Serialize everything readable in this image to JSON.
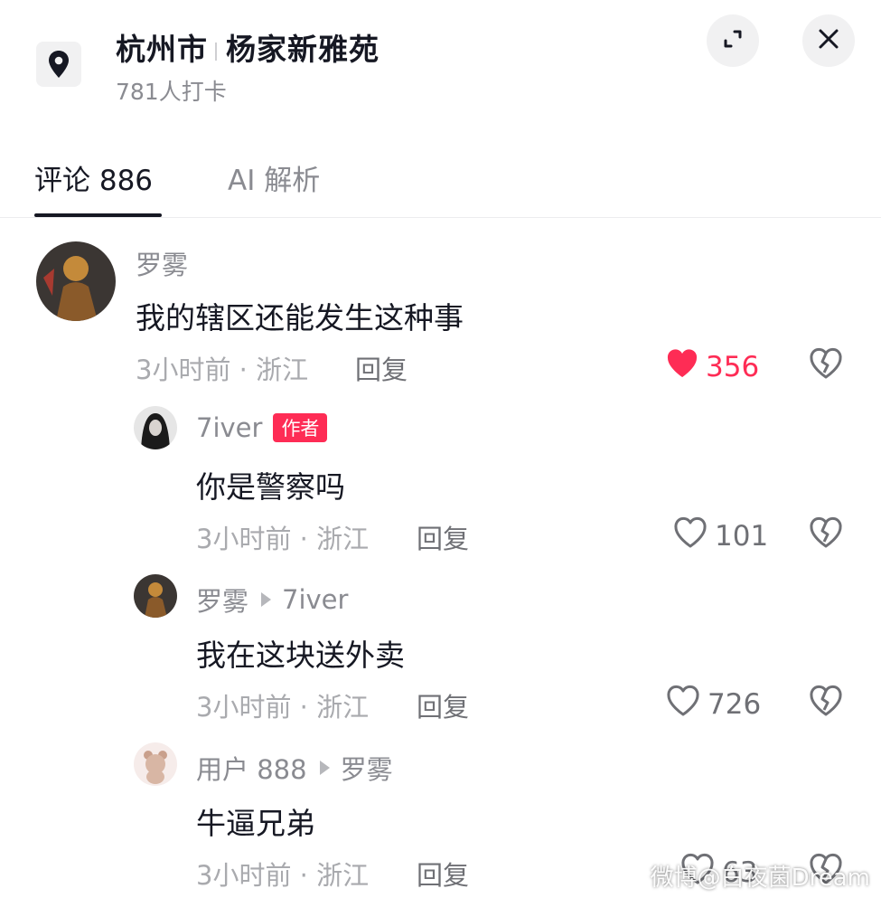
{
  "header": {
    "city": "杭州市",
    "place": "杨家新雅苑",
    "checkins": "781人打卡"
  },
  "tabs": [
    {
      "label": "评论 886",
      "active": true
    },
    {
      "label": "AI 解析",
      "active": false
    }
  ],
  "comments": [
    {
      "author": "罗雾",
      "text": "我的辖区还能发生这种事",
      "time_location": "3小时前 · 浙江",
      "reply_label": "回复",
      "likes": "356",
      "liked": true
    },
    {
      "author": "7iver",
      "badge": "作者",
      "text": "你是警察吗",
      "time_location": "3小时前 · 浙江",
      "reply_label": "回复",
      "likes": "101",
      "liked": false
    },
    {
      "author": "罗雾",
      "reply_to": "7iver",
      "text": "我在这块送外卖",
      "time_location": "3小时前 · 浙江",
      "reply_label": "回复",
      "likes": "726",
      "liked": false
    },
    {
      "author": "用户 888",
      "reply_to": "罗雾",
      "text": "牛逼兄弟",
      "time_location": "3小时前 · 浙江",
      "reply_label": "回复",
      "likes": "63",
      "liked": false
    }
  ],
  "watermark": "微博@白夜菌Dream",
  "colors": {
    "accent": "#fe2c55",
    "text": "#161823",
    "muted": "#8a8b91"
  }
}
